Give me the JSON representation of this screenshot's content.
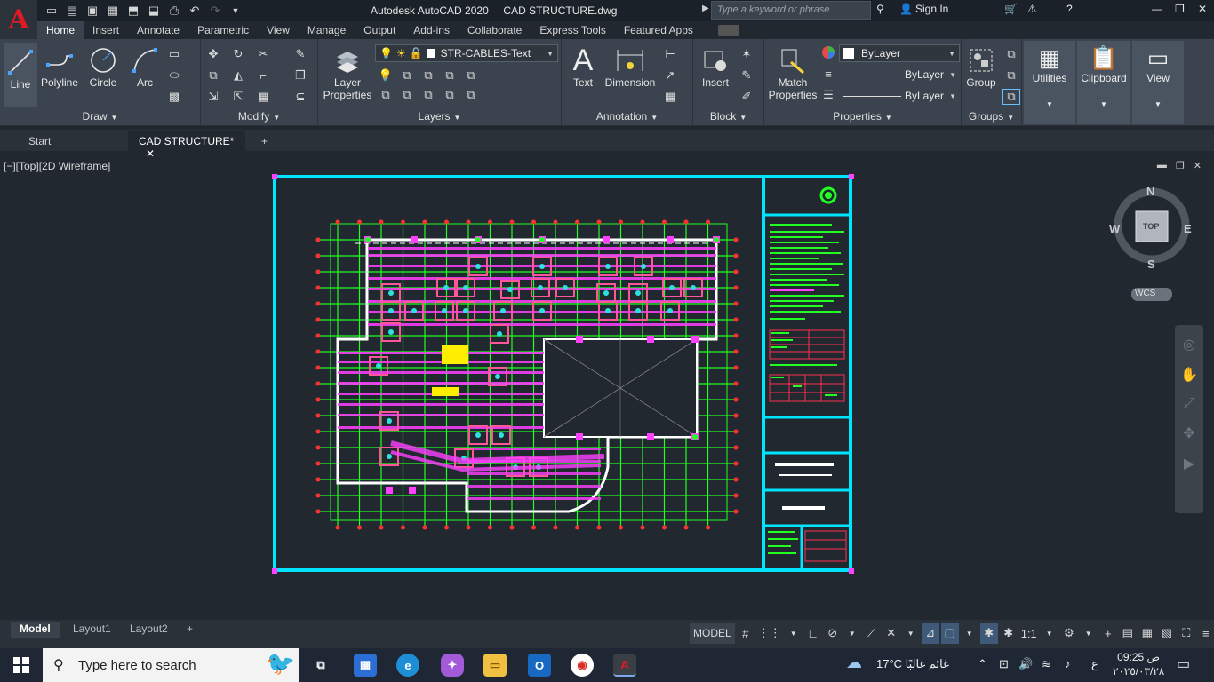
{
  "titlebar": {
    "title": "Autodesk AutoCAD 2020     CAD STRUCTURE.dwg",
    "search_placeholder": "Type a keyword or phrase",
    "sign_in": "Sign In"
  },
  "ribbon_tabs": [
    "Home",
    "Insert",
    "Annotate",
    "Parametric",
    "View",
    "Manage",
    "Output",
    "Add-ins",
    "Collaborate",
    "Express Tools",
    "Featured Apps"
  ],
  "draw_panel": {
    "title": "Draw",
    "line": "Line",
    "polyline": "Polyline",
    "circle": "Circle",
    "arc": "Arc"
  },
  "modify_panel": {
    "title": "Modify"
  },
  "layers_panel": {
    "title": "Layers",
    "layer_properties_1": "Layer",
    "layer_properties_2": "Properties",
    "current_layer": "STR-CABLES-Text"
  },
  "annotation_panel": {
    "title": "Annotation",
    "text": "Text",
    "dimension": "Dimension"
  },
  "block_panel": {
    "title": "Block",
    "insert": "Insert"
  },
  "properties_panel": {
    "title": "Properties",
    "match_1": "Match",
    "match_2": "Properties",
    "color": "ByLayer",
    "linetype": "ByLayer",
    "lineweight": "ByLayer"
  },
  "groups_panel": {
    "title": "Groups",
    "group": "Group"
  },
  "utilities": "Utilities",
  "clipboard": "Clipboard",
  "view": "View",
  "file_tabs": {
    "start": "Start",
    "current": "CAD STRUCTURE*"
  },
  "viewport_label": "[−][Top][2D Wireframe]",
  "viewcube": {
    "n": "N",
    "s": "S",
    "e": "E",
    "w": "W",
    "top": "TOP",
    "wcs": "WCS"
  },
  "layout_tabs": [
    "Model",
    "Layout1",
    "Layout2"
  ],
  "status": {
    "model": "MODEL",
    "scale": "1:1"
  },
  "taskbar": {
    "search_placeholder": "Type here to search",
    "weather": "17°C  غائم غالبًا",
    "time": "09:25 ص",
    "date": "٢٠٢٥/٠٣/٢٨",
    "lang": "ع"
  },
  "colors": {
    "accent": "#3b444e",
    "border_cyan": "#00e5ff",
    "beam_magenta": "#ff40ff",
    "grid_green": "#22ff22"
  }
}
